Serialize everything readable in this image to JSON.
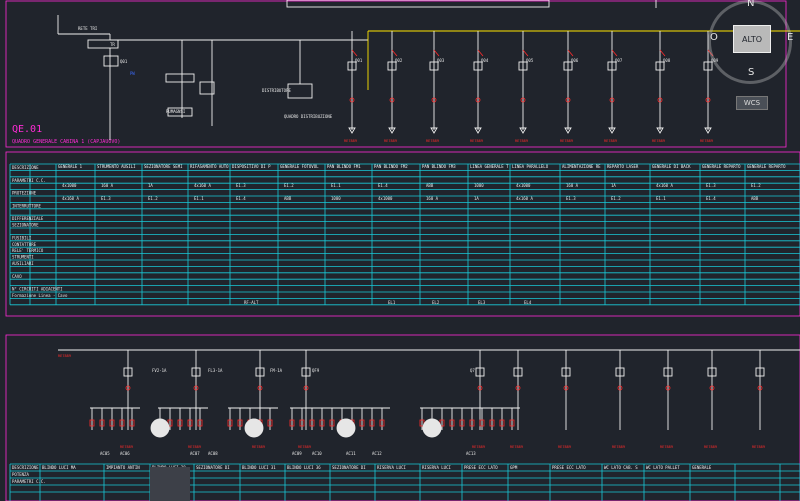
{
  "drawing": {
    "panel_id": "QE.01",
    "panel_title": "QUADRO GENERALE CABINA 1 (CAPJAUOVO)",
    "top_ref": "RETE TRI",
    "tr_label": "TR",
    "q01_label": "Q01",
    "breaker_labels": [
      "QE.1",
      "Q01",
      "Q02",
      "Q03",
      "Q04",
      "Q05",
      "Q06",
      "Q07",
      "Q08",
      "Q09"
    ],
    "out_labels": [
      "RE7889",
      "RE7889",
      "RE7889",
      "RE7889",
      "RE7889",
      "RE7889",
      "RE7889",
      "RE7889",
      "RE7889"
    ],
    "aux_labels": [
      "RUMAGNSI",
      "Q1",
      "DISTRIBUTORE",
      "QUADRO DISTRIBUZIONE"
    ]
  },
  "table_top": {
    "row_headers": [
      "DESCRIZIONE",
      "PARAMETRI C.C.",
      "PROTEZIONE",
      "INTERRUTTORE",
      "DIFFERENZIALE",
      "SEZIONATORE",
      "FUSIBILI",
      "CONTATTORE",
      "RELE' TERMICO",
      "STRUMENTI",
      "AUSILIARI",
      "CAVO",
      "N° CIRCUITI ADIACENTI",
      "Formazione Linea - Cavo"
    ],
    "col_headers": [
      "GENERALE 1",
      "STRUMENTO AUSILIARI",
      "SEZIONATORE SEMINTENSINO",
      "RIFASAMENTO AUTOMATICO",
      "DISPOSITIVO DI PROTEZIONE DI INTERFACCIA FV",
      "GENERALE FOTOVOLTAICO",
      "PAN BLINDO FM1",
      "PAN BLINDO FM2",
      "PAN BLINDO FM3",
      "LINEA GENERALE TERRAZA",
      "LINEA PARALLELO CABINA 4 CONDIZIONAMENTO",
      "ALIMENTAZIONE REPARTO SPEDIZIONI (MAGAZZINO)",
      "REPARTO LASER",
      "GENERALE DI BACK-UP",
      "GENERALE REPARTO PRODUZIONE",
      "GENERALE REPARTO"
    ],
    "cell_samples": [
      "ABB",
      "1000",
      "4x1000",
      "160 A",
      "1A",
      "4x160 A",
      "E1.3",
      "E1.2",
      "E1.1",
      "E1.4"
    ],
    "bottom_refs": [
      "RF-ALT",
      "EL1",
      "EL2",
      "EL3",
      "EL4"
    ]
  },
  "table_bottom": {
    "row_headers": [
      "DESCRIZIONE",
      "POTENZA",
      "PARAMETRI C.C."
    ],
    "col_headers": [
      "BLINDO LUCI MAGAZZINO SPEDIZIONI",
      "IMPIANTO ANTINCENDIO",
      "BLINDO LUCI 28-29-30 FASE",
      "SEZIONATORE DI ENERGIA ELETTRICA",
      "BLINDO LUCI 31-32-33-34-35 MAGAZZINO FV/L",
      "BLINDO LUCI 36-37-38 MAGAZZINO FV/M",
      "SEZIONATORE DI ENERGIA ELETTRICA",
      "RISERVA LUCI",
      "RISERVA LUCI",
      "PRESE ECC LATO CABINA CONDIZIONAMENTO",
      "GPM",
      "PRESE ECC LATO STRADA",
      "WC LATO CAB. STRADA",
      "WC LATO PALLETS",
      "GENERALE"
    ],
    "red_refs": [
      "RE7889",
      "RE7889",
      "RE7889",
      "RE7889",
      "RE7889",
      "RE7889",
      "RE7889",
      "RE7889",
      "RE7889",
      "RE7889",
      "RE7889",
      "RE7889",
      "RE7889",
      "RE7889",
      "RE7889",
      "RE7889"
    ]
  },
  "mid_labels": [
    "AC05",
    "AC06",
    "AC07",
    "AC08",
    "AC09",
    "AC10",
    "AC11",
    "AC12",
    "AC13"
  ],
  "mid_refs": [
    "FV2-1A",
    "FL3-1A",
    "FM-1A",
    "QF9",
    "Q7"
  ],
  "nav": {
    "north": "N",
    "west": "O",
    "east": "E",
    "south": "S",
    "center": "ALTO",
    "wcs": "WCS"
  },
  "colors": {
    "background": "#20242c",
    "table_lines": "#19c9d8",
    "wires": "#f0f0f0",
    "protection": "#ff2a2a",
    "frame": "#ff2bd6",
    "feeder": "#ffe600"
  }
}
